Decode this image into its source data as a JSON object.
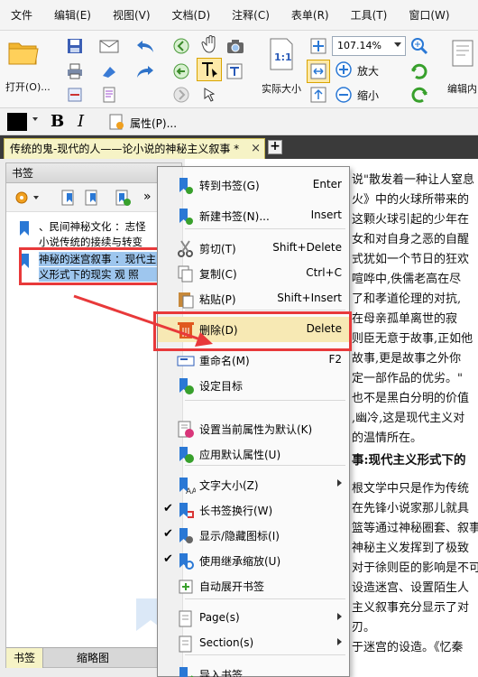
{
  "menubar": {
    "items": [
      "文件",
      "编辑(E)",
      "视图(V)",
      "文档(D)",
      "注释(C)",
      "表单(R)",
      "工具(T)",
      "窗口(W)"
    ]
  },
  "ribbon": {
    "open_label": "打开(O)...",
    "actual_size_label": "实际大小",
    "zoom_value": "107.14%",
    "zoom_in_label": "放大",
    "zoom_out_label": "缩小",
    "edit_content_label": "编辑内",
    "icons": [
      "folder-open-icon",
      "save-icon",
      "print-icon",
      "email-icon",
      "undo-icon",
      "back-icon",
      "hand-icon",
      "snapshot-icon",
      "select-text-icon",
      "fit-page-icon",
      "zoom-in-icon",
      "zoom-out-icon",
      "rotate-icon"
    ]
  },
  "fmtbar": {
    "bold": "B",
    "italic": "I",
    "properties_label": "属性(P)..."
  },
  "tabs": {
    "doc_tab_title": "传统的鬼-现代的人——论小说的神秘主义叙事 *",
    "close_glyph": "×",
    "add_glyph": "+"
  },
  "bookmark_panel": {
    "title": "书签",
    "items": [
      {
        "line1": "、民间神秘文化 ：志怪",
        "line2": "小说传统的接续与转变"
      },
      {
        "line1": "神秘的迷宫叙事 ：现代主",
        "line2": "义形式下的现实  观 照"
      }
    ],
    "bottom_tabs": [
      "书签",
      "缩略图"
    ]
  },
  "document": {
    "lines": [
      "说\"散发着一种让人窒息",
      "火》中的火球所带来的",
      "这颗火球引起的少年在",
      "女和对自身之恶的自醒",
      "式犹如一个节日的狂欢",
      "喧哗中,佚儒老高在尽",
      "了和孝道伦理的对抗,",
      "在母亲孤单离世的寂",
      "则臣无意于故事,正如他",
      "故事,更是故事之外你",
      "定一部作品的优劣。\"",
      "也不是黑白分明的价值",
      ",幽冷,这是现代主义对",
      "的温情所在。",
      "事:现代主义形式下的",
      "根文学中只是作为传统",
      "在先锋小说家那儿就具",
      "篮等通过神秘圈套、叙事",
      "神秘主义发挥到了极致",
      "对于徐则臣的影响是不可",
      "设造迷宫、设置陌生人",
      "主义叙事充分显示了对",
      "刃。",
      "于迷宫的设造。《忆秦"
    ]
  },
  "context_menu": {
    "items": [
      {
        "label": "转到书签(G)",
        "shortcut": "Enter",
        "icon": "goto-bookmark-icon"
      },
      {
        "label": "新建书签(N)...",
        "shortcut": "Insert",
        "icon": "new-bookmark-icon"
      },
      {
        "label": "剪切(T)",
        "shortcut": "Shift+Delete",
        "icon": "scissors-icon"
      },
      {
        "label": "复制(C)",
        "shortcut": "Ctrl+C",
        "icon": "copy-icon"
      },
      {
        "label": "粘贴(P)",
        "shortcut": "Shift+Insert",
        "icon": "paste-icon"
      },
      {
        "label": "删除(D)",
        "shortcut": "Delete",
        "icon": "trash-icon"
      },
      {
        "label": "重命名(M)",
        "shortcut": "F2",
        "icon": "rename-icon"
      },
      {
        "label": "设定目标",
        "shortcut": "",
        "icon": "set-target-icon"
      },
      {
        "label": "设置当前属性为默认(K)",
        "shortcut": "",
        "icon": "set-default-icon"
      },
      {
        "label": "应用默认属性(U)",
        "shortcut": "",
        "icon": "apply-default-icon"
      },
      {
        "label": "文字大小(Z)",
        "shortcut": "",
        "icon": "text-size-icon"
      },
      {
        "label": "长书签换行(W)",
        "shortcut": "",
        "icon": "wrap-bookmark-icon"
      },
      {
        "label": "显示/隐藏图标(I)",
        "shortcut": "",
        "icon": "show-hide-icon"
      },
      {
        "label": "使用继承缩放(U)",
        "shortcut": "",
        "icon": "inherit-zoom-icon"
      },
      {
        "label": "自动展开书签",
        "shortcut": "",
        "icon": "auto-expand-icon"
      },
      {
        "label": "Page(s)",
        "shortcut": "",
        "icon": "pages-icon"
      },
      {
        "label": "Section(s)",
        "shortcut": "",
        "icon": "sections-icon"
      },
      {
        "label": "导入书签",
        "shortcut": "",
        "icon": "import-bookmark-icon"
      }
    ],
    "check_glyph": "✔"
  },
  "colors": {
    "highlight_red": "#e8393a",
    "selection_blue": "#9ec6ee",
    "tab_yellow": "#f6f3c6",
    "menu_hover": "#f7e9b4"
  }
}
